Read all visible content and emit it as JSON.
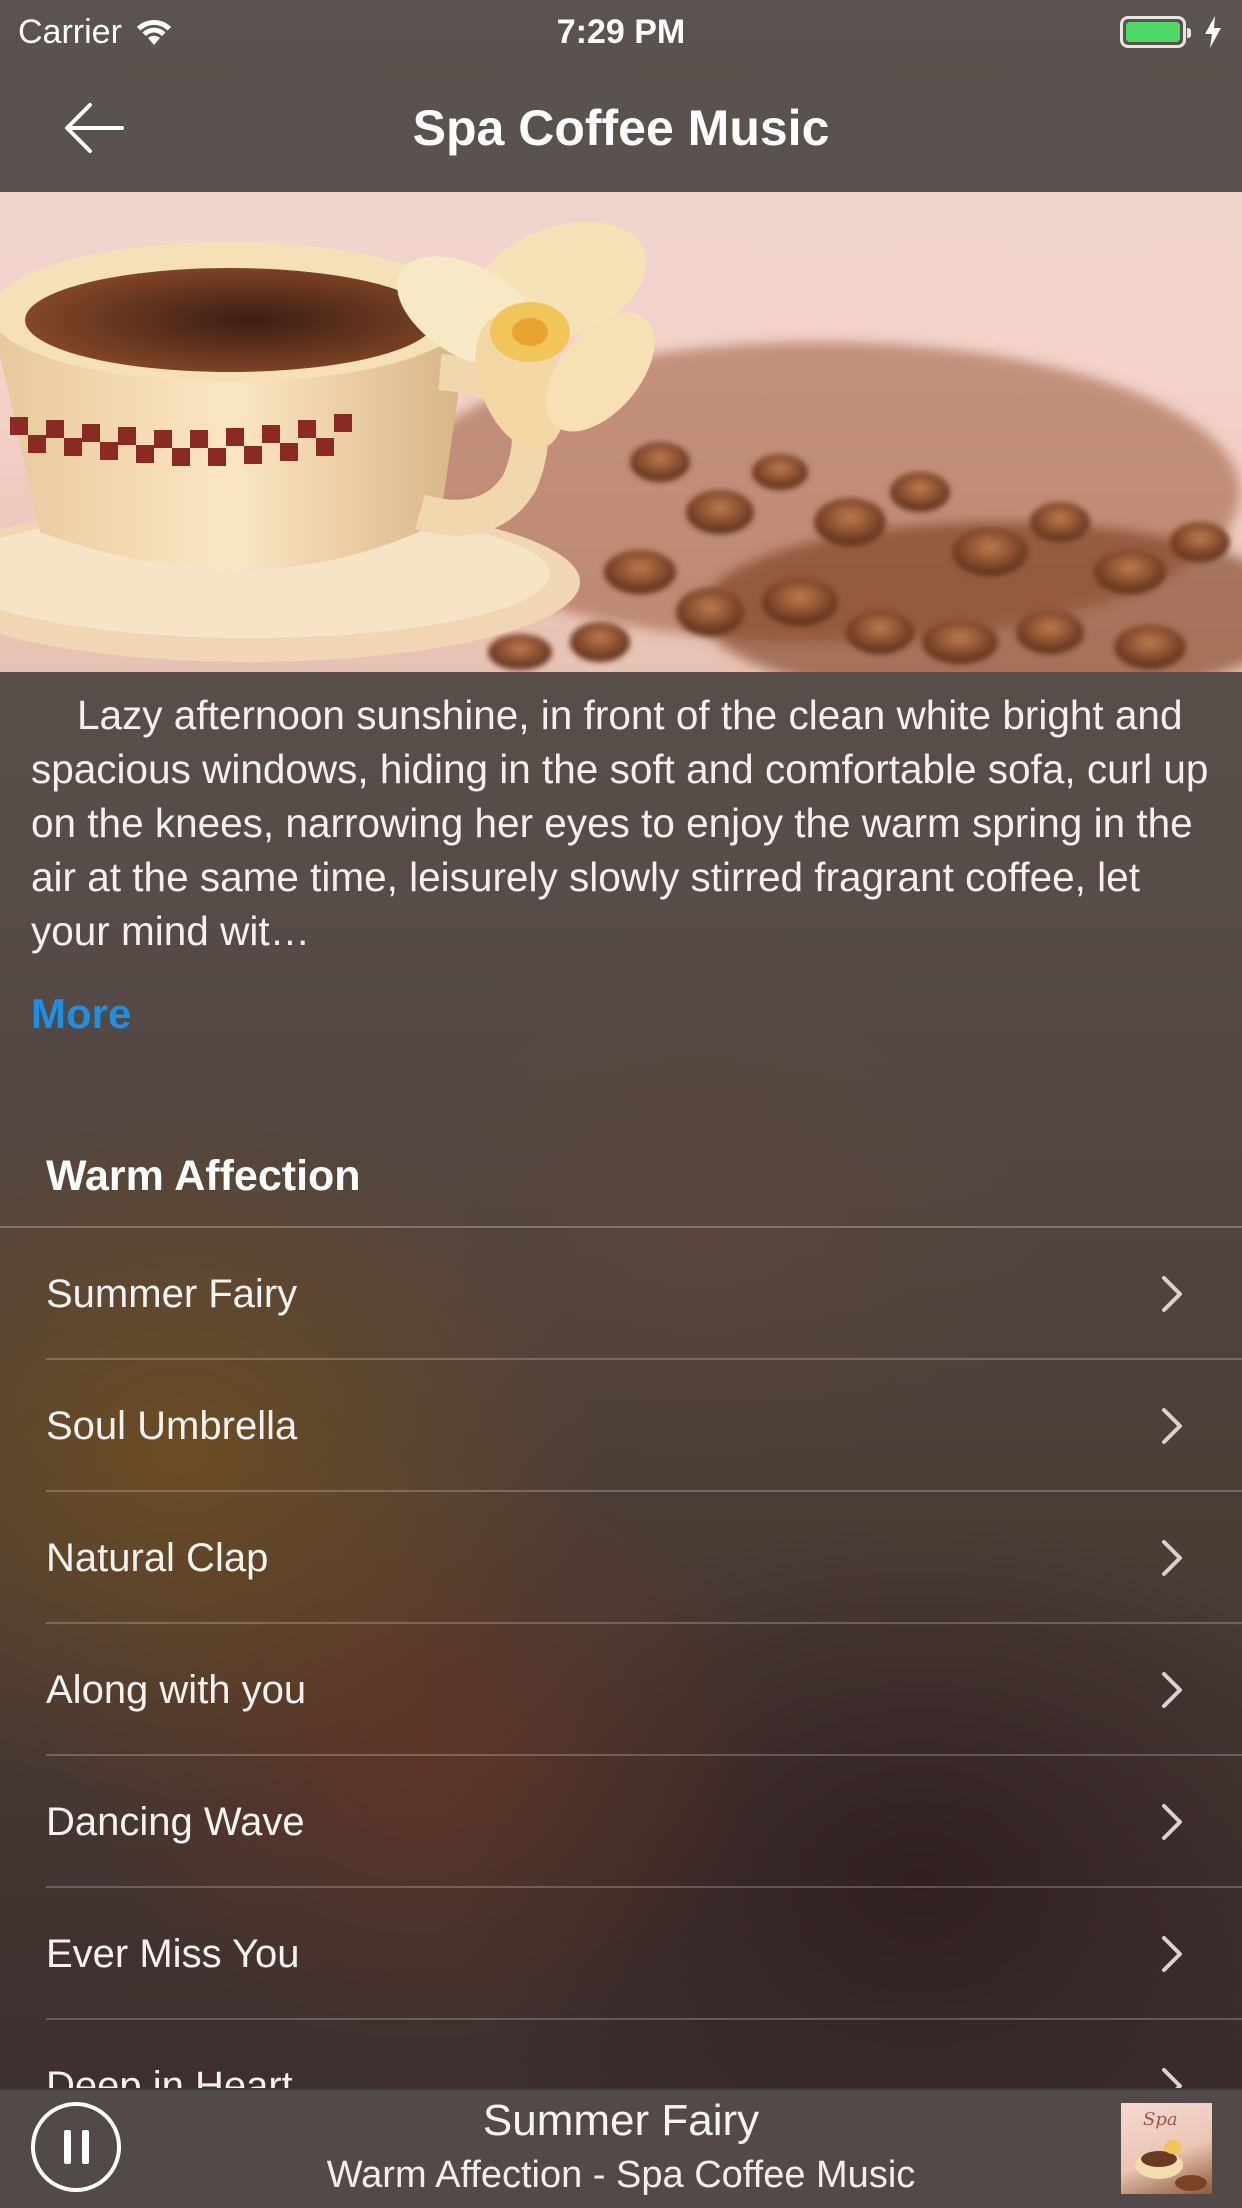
{
  "status_bar": {
    "carrier": "Carrier",
    "time": "7:29 PM",
    "battery_color": "#4cd964"
  },
  "nav": {
    "title": "Spa Coffee Music",
    "back_icon": "arrow-left-icon"
  },
  "hero": {
    "image": "coffee-cup-with-flower-and-beans"
  },
  "description": {
    "text": "Lazy afternoon sunshine, in front of the clean white bright and spacious windows, hiding in the soft and comfortable sofa, curl up on the knees, narrowing her eyes to enjoy the warm spring in the air at the same time, leisurely slowly stirred fragrant coffee, let your mind wit…",
    "more_label": "More",
    "more_color": "#1f8fe3"
  },
  "section": {
    "title": "Warm Affection"
  },
  "tracks": [
    {
      "title": "Summer Fairy"
    },
    {
      "title": "Soul Umbrella"
    },
    {
      "title": "Natural Clap"
    },
    {
      "title": "Along with you"
    },
    {
      "title": "Dancing Wave"
    },
    {
      "title": "Ever Miss You"
    },
    {
      "title": "Deep in Heart"
    }
  ],
  "player": {
    "title": "Summer Fairy",
    "subtitle": "Warm Affection - Spa Coffee Music",
    "state_icon": "pause-icon",
    "album_label": "Spa"
  }
}
